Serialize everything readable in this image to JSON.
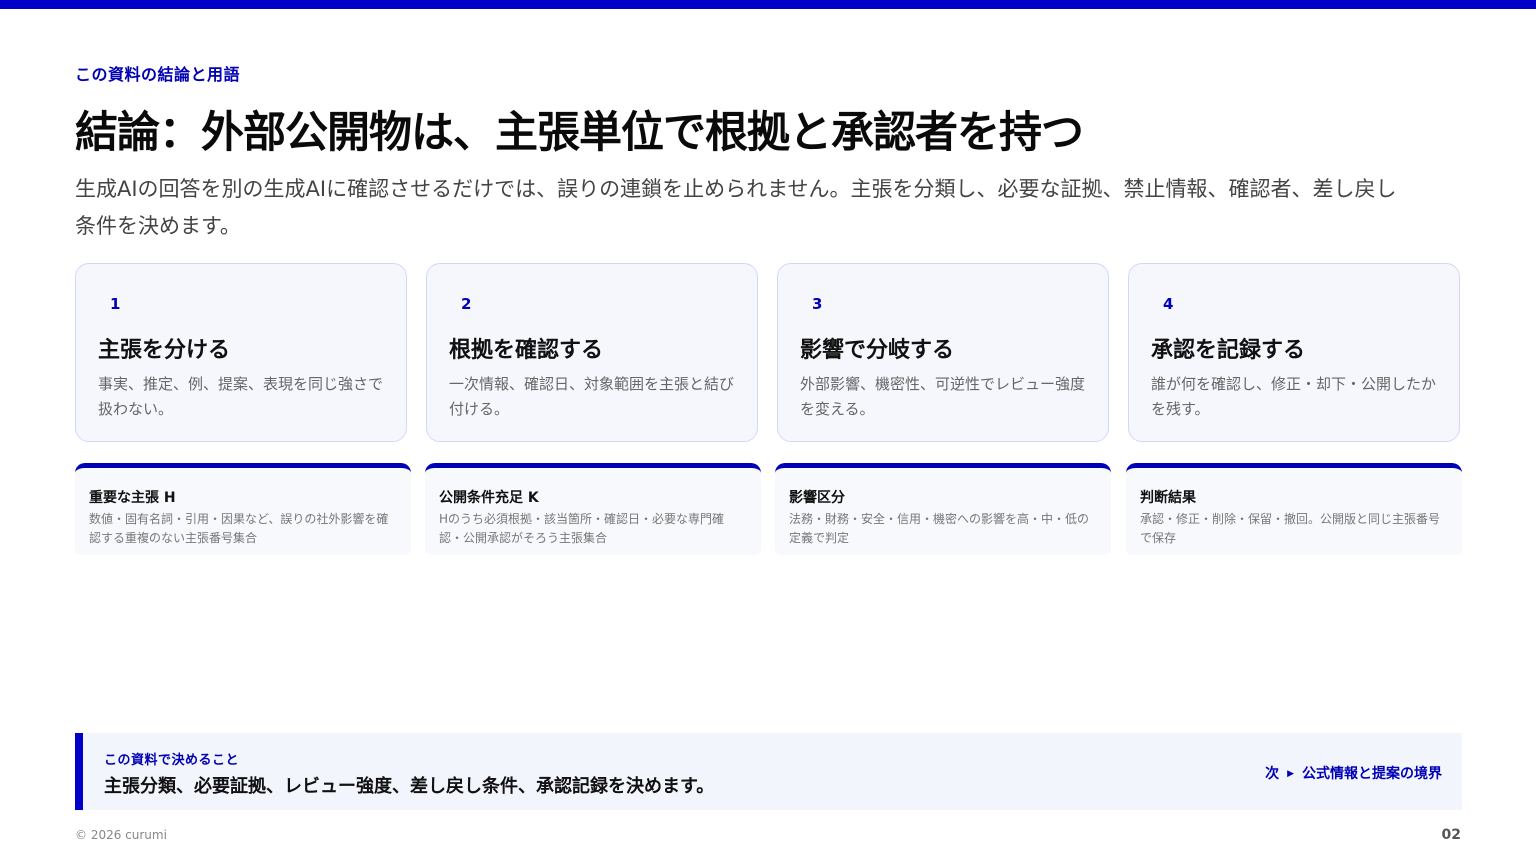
{
  "colors": {
    "accent": "#0000c8",
    "card_bg": "#f5f7fd",
    "card_border": "#d4d8f4",
    "text_muted": "#666666"
  },
  "header": {
    "eyebrow": "この資料の結論と用語",
    "title": "結論：外部公開物は、主張単位で根拠と承認者を持つ",
    "lead": "生成AIの回答を別の生成AIに確認させるだけでは、誤りの連鎖を止められません。主張を分類し、必要な証拠、禁止情報、確認者、差し戻し条件を決めます。"
  },
  "steps": [
    {
      "num": "1",
      "title": "主張を分ける",
      "desc": "事実、推定、例、提案、表現を同じ強さで扱わない。"
    },
    {
      "num": "2",
      "title": "根拠を確認する",
      "desc": "一次情報、確認日、対象範囲を主張と結び付ける。"
    },
    {
      "num": "3",
      "title": "影響で分岐する",
      "desc": "外部影響、機密性、可逆性でレビュー強度を変える。"
    },
    {
      "num": "4",
      "title": "承認を記録する",
      "desc": "誰が何を確認し、修正・却下・公開したかを残す。"
    }
  ],
  "terms": [
    {
      "title": "重要な主張 H",
      "desc": "数値・固有名詞・引用・因果など、誤りの社外影響を確認する重複のない主張番号集合"
    },
    {
      "title": "公開条件充足 K",
      "desc": "Hのうち必須根拠・該当箇所・確認日・必要な専門確認・公開承認がそろう主張集合"
    },
    {
      "title": "影響区分",
      "desc": "法務・財務・安全・信用・機密への影響を高・中・低の定義で判定"
    },
    {
      "title": "判断結果",
      "desc": "承認・修正・削除・保留・撤回。公開版と同じ主張番号で保存"
    }
  ],
  "callout": {
    "label": "この資料で決めること",
    "text": "主張分類、必要証拠、レビュー強度、差し戻し条件、承認記録を決めます。",
    "next_label": "次",
    "next_arrow": "▶",
    "next_title": "公式情報と提案の境界"
  },
  "footer": {
    "copyright": "© 2026 curumi",
    "page": "02"
  }
}
